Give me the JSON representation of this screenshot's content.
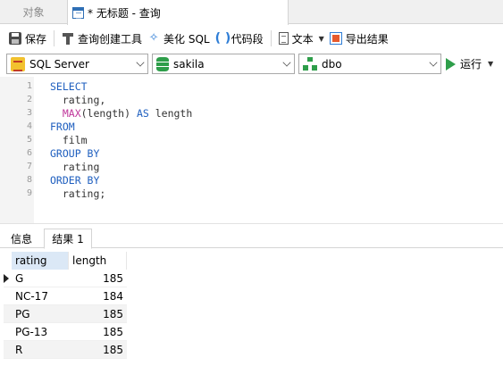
{
  "tabs": {
    "objects_label": "对象",
    "query_label": "* 无标题 - 查询"
  },
  "toolbar": {
    "save": "保存",
    "query_builder": "查询创建工具",
    "beautify_sql": "美化 SQL",
    "code_snippet": "代码段",
    "text": "文本",
    "export_results": "导出结果"
  },
  "connection": {
    "server": "SQL Server",
    "database": "sakila",
    "schema": "dbo",
    "run": "运行"
  },
  "editor": {
    "lines": [
      {
        "num": "1",
        "kw": "SELECT",
        "fn": "",
        "rest": ""
      },
      {
        "num": "2",
        "kw": "",
        "fn": "",
        "rest": "  rating,"
      },
      {
        "num": "3",
        "kw": "",
        "fn": "  MAX",
        "rest": "(length) ",
        "kw2": "AS",
        "rest2": " length"
      },
      {
        "num": "4",
        "kw": "FROM",
        "fn": "",
        "rest": ""
      },
      {
        "num": "5",
        "kw": "",
        "fn": "",
        "rest": "  film"
      },
      {
        "num": "6",
        "kw": "GROUP BY",
        "fn": "",
        "rest": ""
      },
      {
        "num": "7",
        "kw": "",
        "fn": "",
        "rest": "  rating"
      },
      {
        "num": "8",
        "kw": "ORDER BY",
        "fn": "",
        "rest": ""
      },
      {
        "num": "9",
        "kw": "",
        "fn": "",
        "rest": "  rating;"
      }
    ]
  },
  "result_tabs": {
    "info": "信息",
    "result1": "结果 1"
  },
  "grid": {
    "columns": [
      "rating",
      "length"
    ],
    "rows": [
      {
        "rating": "G",
        "length": "185"
      },
      {
        "rating": "NC-17",
        "length": "184"
      },
      {
        "rating": "PG",
        "length": "185"
      },
      {
        "rating": "PG-13",
        "length": "185"
      },
      {
        "rating": "R",
        "length": "185"
      }
    ]
  },
  "colors": {
    "keyword": "#1f5fbf",
    "function": "#c0379b",
    "accent_green": "#2e9e4a",
    "header_highlight": "#dbe8f6"
  },
  "icons": [
    "save-icon",
    "query-builder-icon",
    "beautify-icon",
    "code-snippet-icon",
    "text-icon",
    "export-icon",
    "sql-server-icon",
    "database-icon",
    "schema-icon",
    "run-icon"
  ]
}
